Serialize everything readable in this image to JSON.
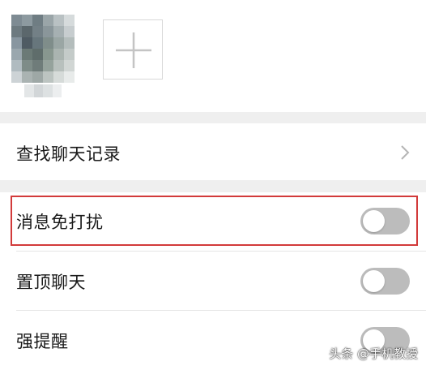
{
  "search_history": {
    "label": "查找聊天记录",
    "chevron_icon": "chevron-right-icon"
  },
  "settings": [
    {
      "key": "mute",
      "label": "消息免打扰",
      "enabled": false
    },
    {
      "key": "pin",
      "label": "置顶聊天",
      "enabled": false
    },
    {
      "key": "remind",
      "label": "强提醒",
      "enabled": false
    }
  ],
  "watermark": "头条 @手机教授",
  "colors": {
    "highlight": "#d23a3a",
    "toggle_off": "#bcbcbc",
    "separator": "#efefef"
  }
}
